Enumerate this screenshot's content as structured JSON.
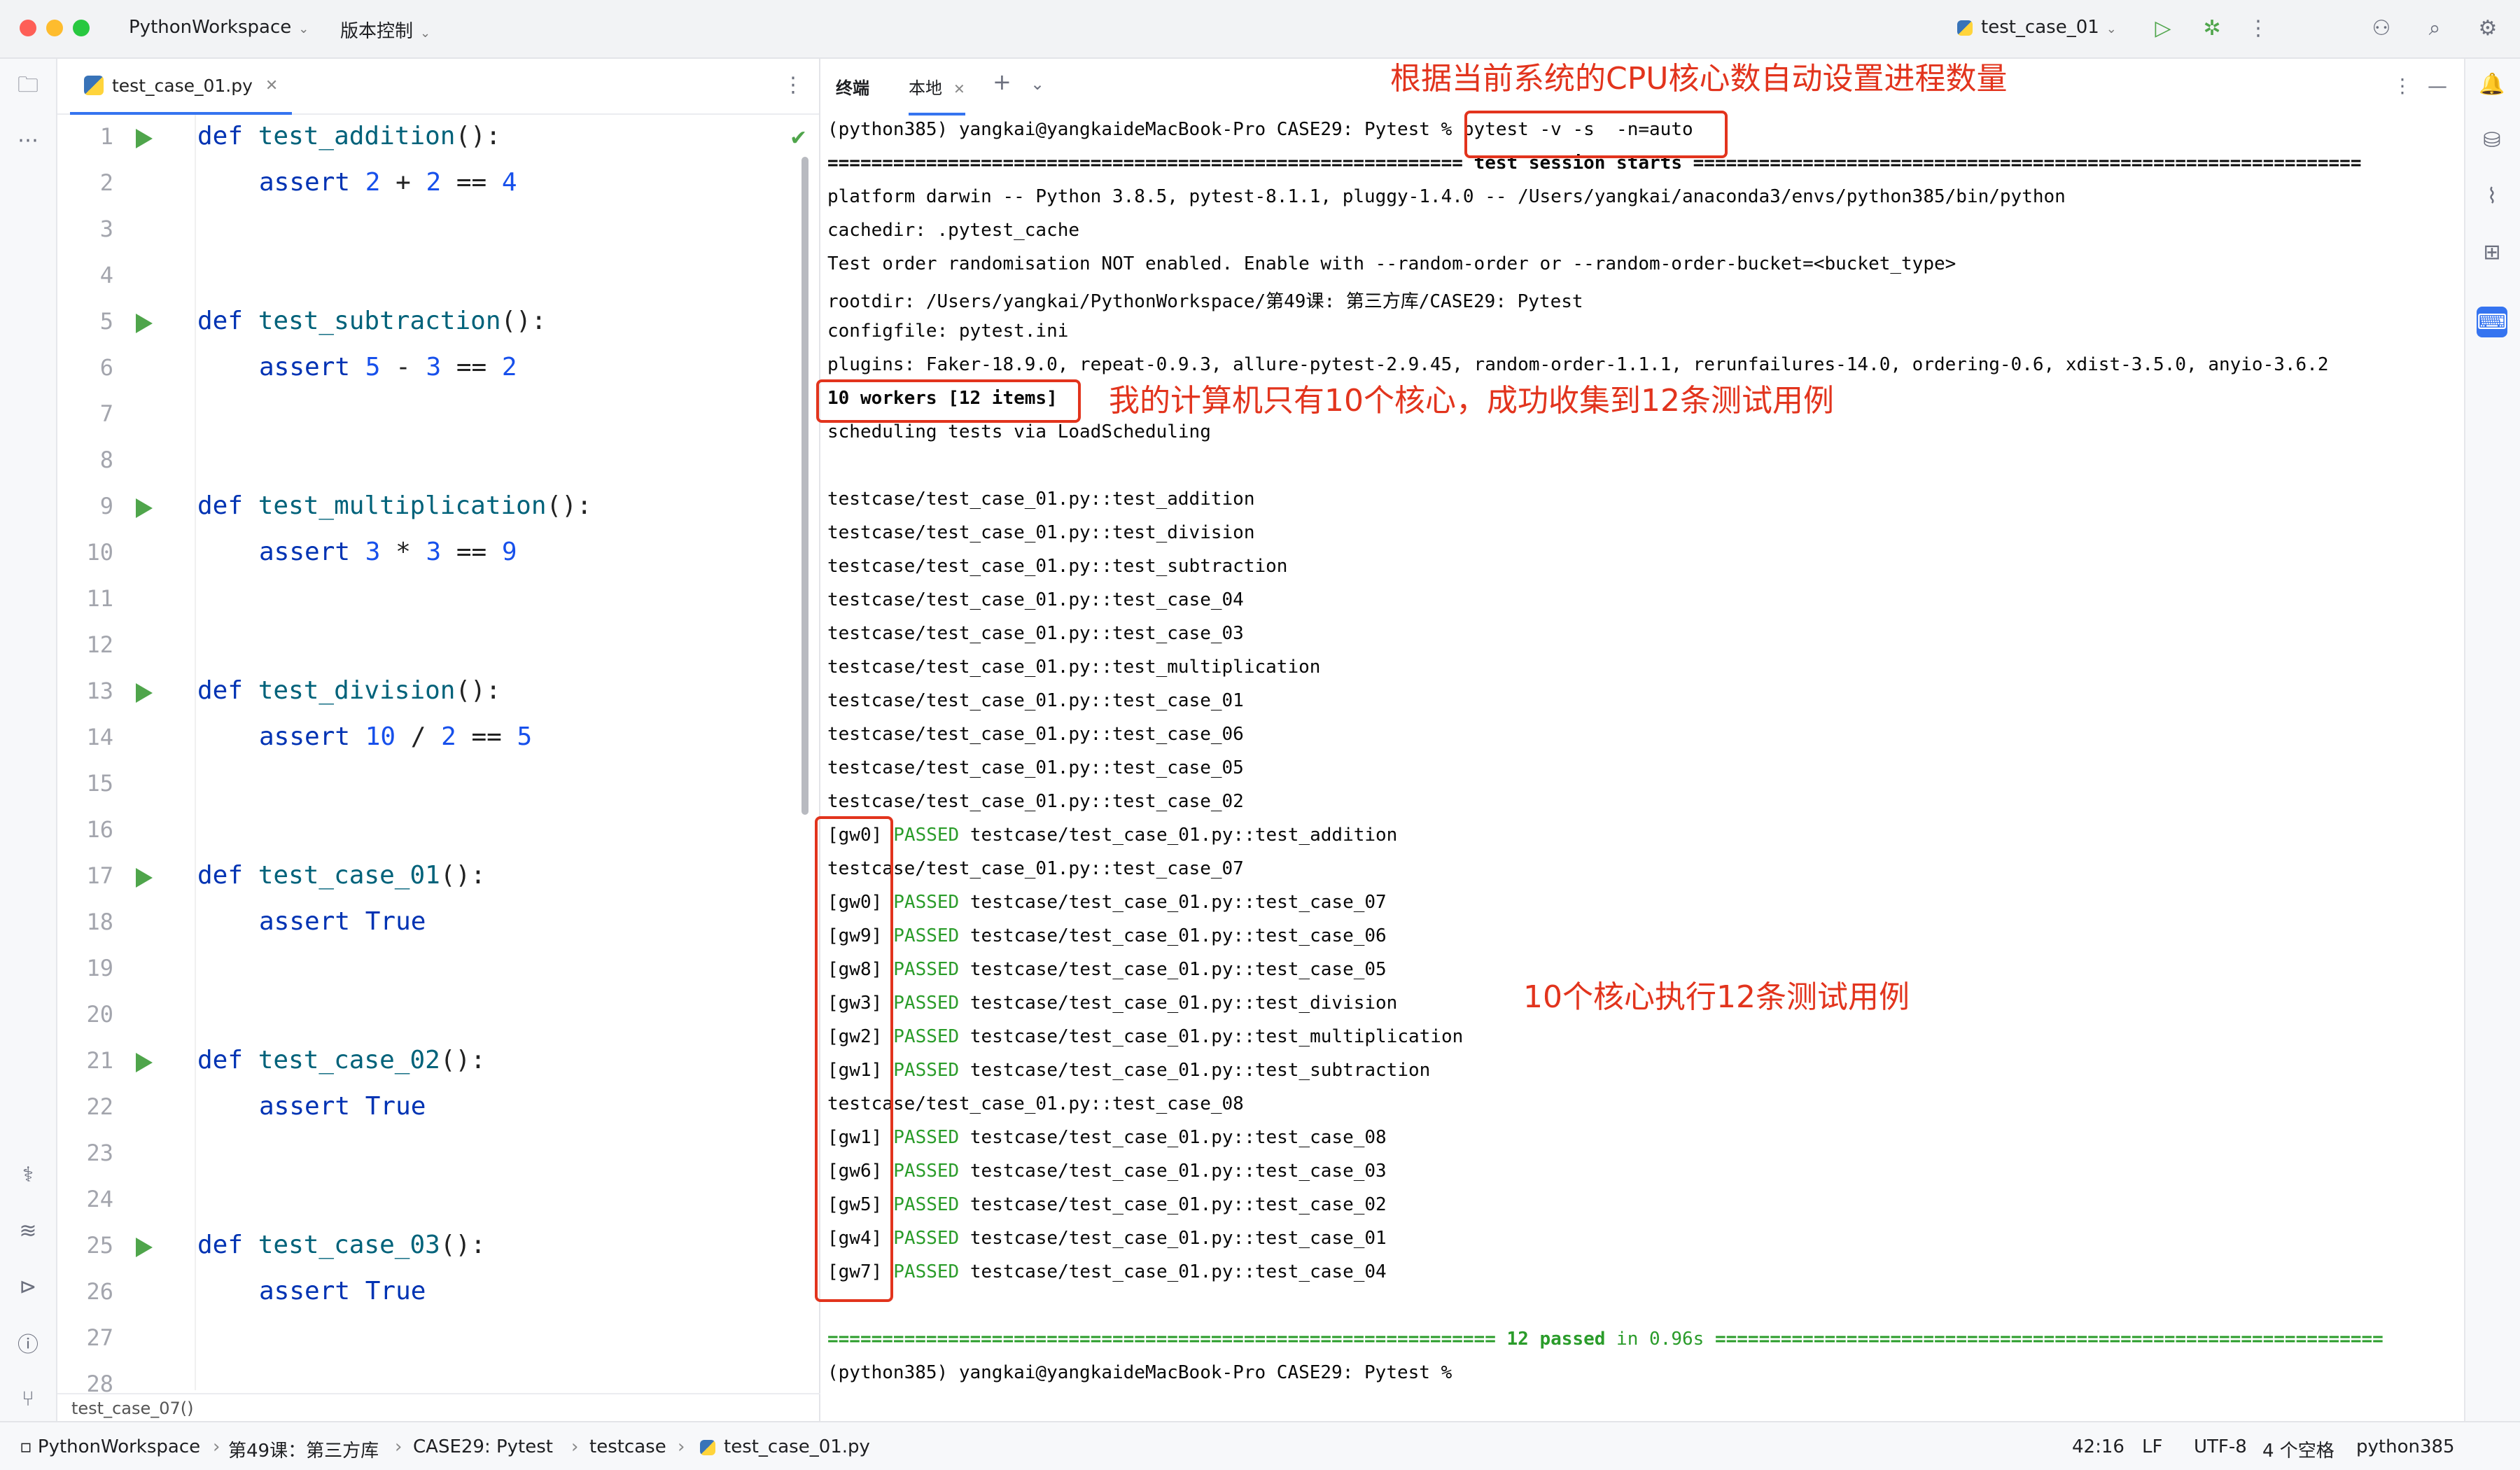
{
  "titlebar": {
    "project": "PythonWorkspace",
    "vcs": "版本控制",
    "run_config": "test_case_01"
  },
  "editor": {
    "tab_label": "test_case_01.py",
    "breadcrumb_bottom": "test_case_07()",
    "line_numbers": [
      "1",
      "2",
      "3",
      "4",
      "5",
      "6",
      "7",
      "8",
      "9",
      "10",
      "11",
      "12",
      "13",
      "14",
      "15",
      "16",
      "17",
      "18",
      "19",
      "20",
      "21",
      "22",
      "23",
      "24",
      "25",
      "26",
      "27",
      "28"
    ]
  },
  "code": {
    "l1": {
      "kw": "def",
      "fn": "test_addition",
      "tail": "():"
    },
    "l2": {
      "kw": "assert",
      "a": "2",
      "op": " + ",
      "b": "2",
      "eq": " == ",
      "r": "4"
    },
    "l5": {
      "kw": "def",
      "fn": "test_subtraction",
      "tail": "():"
    },
    "l6": {
      "kw": "assert",
      "a": "5",
      "op": " - ",
      "b": "3",
      "eq": " == ",
      "r": "2"
    },
    "l9": {
      "kw": "def",
      "fn": "test_multiplication",
      "tail": "():"
    },
    "l10": {
      "kw": "assert",
      "a": "3",
      "op": " * ",
      "b": "3",
      "eq": " == ",
      "r": "9"
    },
    "l13": {
      "kw": "def",
      "fn": "test_division",
      "tail": "():"
    },
    "l14": {
      "kw": "assert",
      "a": "10",
      "op": " / ",
      "b": "2",
      "eq": " == ",
      "r": "5"
    },
    "l17": {
      "kw": "def",
      "fn": "test_case_01",
      "tail": "():"
    },
    "l18": {
      "kw": "assert",
      "val": "True"
    },
    "l21": {
      "kw": "def",
      "fn": "test_case_02",
      "tail": "():"
    },
    "l22": {
      "kw": "assert",
      "val": "True"
    },
    "l25": {
      "kw": "def",
      "fn": "test_case_03",
      "tail": "():"
    },
    "l26": {
      "kw": "assert",
      "val": "True"
    }
  },
  "terminal": {
    "tab_terminal": "终端",
    "tab_local": "本地",
    "prompt": "(python385) yangkai@yangkaideMacBook-Pro CASE29: Pytest % ",
    "command": "pytest -v -s  -n=auto",
    "session_sep_left": "==========================================================",
    "session_title": " test session starts ",
    "session_sep_right": "=============================================================",
    "platform": "platform darwin -- Python 3.8.5, pytest-8.1.1, pluggy-1.4.0 -- /Users/yangkai/anaconda3/envs/python385/bin/python",
    "cachedir": "cachedir: .pytest_cache",
    "order": "Test order randomisation NOT enabled. Enable with --random-order or --random-order-bucket=<bucket_type>",
    "rootdir": "rootdir: /Users/yangkai/PythonWorkspace/第49课: 第三方库/CASE29: Pytest",
    "configfile": "configfile: pytest.ini",
    "plugins": "plugins: Faker-18.9.0, repeat-0.9.3, allure-pytest-2.9.45, random-order-1.1.1, rerunfailures-14.0, ordering-0.6, xdist-3.5.0, anyio-3.6.2",
    "workers": "10 workers [12 items]",
    "scheduling": "scheduling tests via LoadScheduling",
    "collected": [
      "testcase/test_case_01.py::test_addition",
      "testcase/test_case_01.py::test_division",
      "testcase/test_case_01.py::test_subtraction",
      "testcase/test_case_01.py::test_case_04",
      "testcase/test_case_01.py::test_case_03",
      "testcase/test_case_01.py::test_multiplication",
      "testcase/test_case_01.py::test_case_01",
      "testcase/test_case_01.py::test_case_06",
      "testcase/test_case_01.py::test_case_05",
      "testcase/test_case_01.py::test_case_02"
    ],
    "results": [
      {
        "w": "[gw0]",
        "s": "PASSED",
        "t": " testcase/test_case_01.py::test_addition"
      },
      {
        "plain": "testcase/test_case_01.py::test_case_07"
      },
      {
        "w": "[gw0]",
        "s": "PASSED",
        "t": " testcase/test_case_01.py::test_case_07"
      },
      {
        "w": "[gw9]",
        "s": "PASSED",
        "t": " testcase/test_case_01.py::test_case_06"
      },
      {
        "w": "[gw8]",
        "s": "PASSED",
        "t": " testcase/test_case_01.py::test_case_05"
      },
      {
        "w": "[gw3]",
        "s": "PASSED",
        "t": " testcase/test_case_01.py::test_division"
      },
      {
        "w": "[gw2]",
        "s": "PASSED",
        "t": " testcase/test_case_01.py::test_multiplication"
      },
      {
        "w": "[gw1]",
        "s": "PASSED",
        "t": " testcase/test_case_01.py::test_subtraction"
      },
      {
        "plain": "testcase/test_case_01.py::test_case_08"
      },
      {
        "w": "[gw1]",
        "s": "PASSED",
        "t": " testcase/test_case_01.py::test_case_08"
      },
      {
        "w": "[gw6]",
        "s": "PASSED",
        "t": " testcase/test_case_01.py::test_case_03"
      },
      {
        "w": "[gw5]",
        "s": "PASSED",
        "t": " testcase/test_case_01.py::test_case_02"
      },
      {
        "w": "[gw4]",
        "s": "PASSED",
        "t": " testcase/test_case_01.py::test_case_01"
      },
      {
        "w": "[gw7]",
        "s": "PASSED",
        "t": " testcase/test_case_01.py::test_case_04"
      }
    ],
    "summary_left": "=============================================================",
    "summary_mid": " 12 passed",
    "summary_in": " in 0.96s ",
    "summary_right": "=============================================================",
    "final_prompt": "(python385) yangkai@yangkaideMacBook-Pro CASE29: Pytest %"
  },
  "annotations": {
    "a1": "根据当前系统的CPU核心数自动设置进程数量",
    "a2": "我的计算机只有10个核心，成功收集到12条测试用例",
    "a3": "10个核心执行12条测试用例"
  },
  "statusbar": {
    "project": "PythonWorkspace",
    "c1": "第49课：第三方库",
    "c2": "CASE29: Pytest",
    "c3": "testcase",
    "c4": "test_case_01.py",
    "position": "42:16",
    "lf": "LF",
    "encoding": "UTF-8",
    "indent": "4 个空格",
    "interpreter": "python385"
  }
}
